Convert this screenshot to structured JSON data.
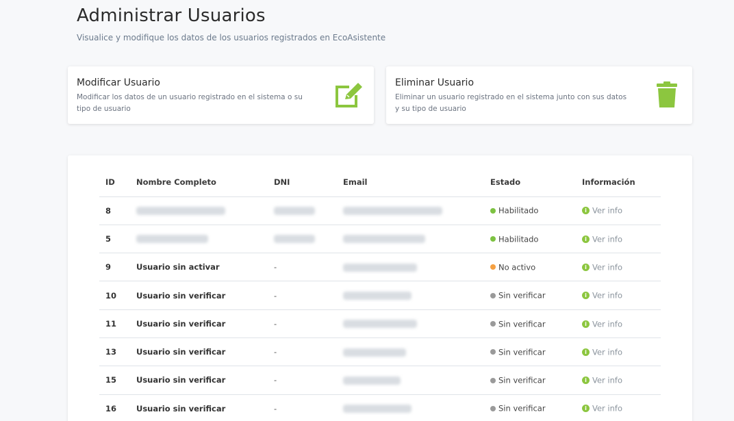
{
  "header": {
    "title": "Administrar Usuarios",
    "subtitle": "Visualice y modifique los datos de los usuarios registrados en EcoAsistente"
  },
  "cards": {
    "modify": {
      "title": "Modificar Usuario",
      "description": "Modificar los datos de un usuario registrado en el sistema o su tipo de usuario",
      "icon": "edit-icon"
    },
    "delete": {
      "title": "Eliminar Usuario",
      "description": "Eliminar un usuario registrado en el sistema junto con sus datos y su tipo de usuario",
      "icon": "trash-icon"
    }
  },
  "colors": {
    "accent_green": "#8cc63f",
    "status_enabled": "#7dc242",
    "status_inactive": "#f5a042",
    "status_unverified": "#9a9a9a"
  },
  "table": {
    "headers": [
      "ID",
      "Nombre Completo",
      "DNI",
      "Email",
      "Estado",
      "Información"
    ],
    "rows": [
      {
        "id": "8",
        "name": "",
        "dni": "",
        "estado": "Habilitado",
        "status_color": "#7dc242",
        "info": "Ver info",
        "redacted": true
      },
      {
        "id": "5",
        "name": "",
        "dni": "",
        "estado": "Habilitado",
        "status_color": "#7dc242",
        "info": "Ver info",
        "redacted": true
      },
      {
        "id": "9",
        "name": "Usuario sin activar",
        "dni": "-",
        "estado": "No activo",
        "status_color": "#f5a042",
        "info": "Ver info"
      },
      {
        "id": "10",
        "name": "Usuario sin verificar",
        "dni": "-",
        "estado": "Sin verificar",
        "status_color": "#9a9a9a",
        "info": "Ver info"
      },
      {
        "id": "11",
        "name": "Usuario sin verificar",
        "dni": "-",
        "estado": "Sin verificar",
        "status_color": "#9a9a9a",
        "info": "Ver info"
      },
      {
        "id": "13",
        "name": "Usuario sin verificar",
        "dni": "-",
        "estado": "Sin verificar",
        "status_color": "#9a9a9a",
        "info": "Ver info"
      },
      {
        "id": "15",
        "name": "Usuario sin verificar",
        "dni": "-",
        "estado": "Sin verificar",
        "status_color": "#9a9a9a",
        "info": "Ver info"
      },
      {
        "id": "16",
        "name": "Usuario sin verificar",
        "dni": "-",
        "estado": "Sin verificar",
        "status_color": "#9a9a9a",
        "info": "Ver info"
      }
    ]
  }
}
